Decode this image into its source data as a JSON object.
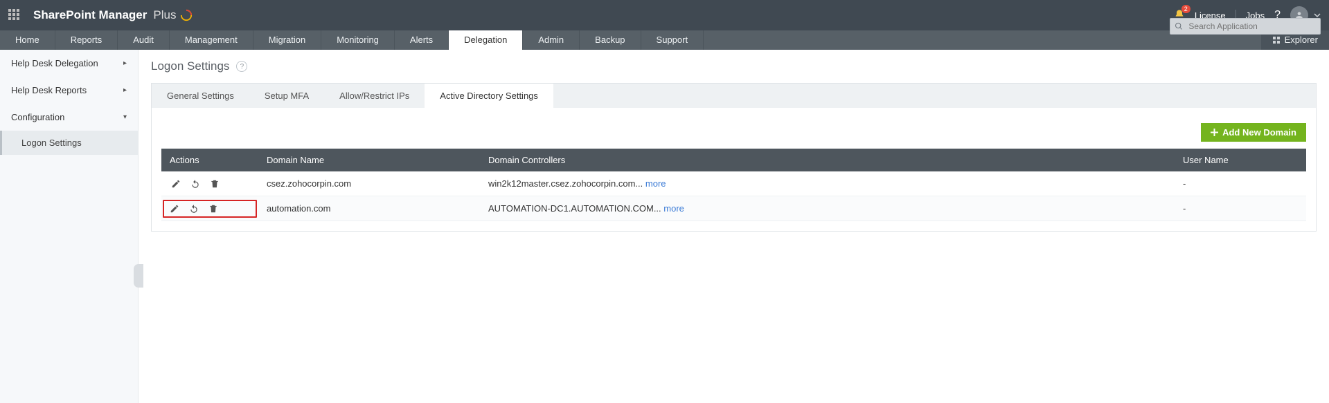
{
  "header": {
    "brand_strong": "SharePoint Manager",
    "brand_light": "Plus",
    "notification_count": "2",
    "license_label": "License",
    "jobs_label": "Jobs",
    "help_label": "?",
    "search_placeholder": "Search Application"
  },
  "nav": {
    "items": [
      "Home",
      "Reports",
      "Audit",
      "Management",
      "Migration",
      "Monitoring",
      "Alerts",
      "Delegation",
      "Admin",
      "Backup",
      "Support"
    ],
    "active_index": 7,
    "explorer_label": "Explorer"
  },
  "sidebar": {
    "items": [
      {
        "label": "Help Desk Delegation",
        "expandable": true,
        "chev": "▸"
      },
      {
        "label": "Help Desk Reports",
        "expandable": true,
        "chev": "▸"
      },
      {
        "label": "Configuration",
        "expandable": true,
        "chev": "▾"
      }
    ],
    "sub_active": "Logon Settings"
  },
  "page": {
    "title": "Logon Settings",
    "tabs": [
      "General Settings",
      "Setup MFA",
      "Allow/Restrict IPs",
      "Active Directory Settings"
    ],
    "active_tab_index": 3,
    "add_btn": "Add New Domain",
    "table": {
      "headers": [
        "Actions",
        "Domain Name",
        "Domain Controllers",
        "User Name"
      ],
      "rows": [
        {
          "domain": "csez.zohocorpin.com",
          "dc": "win2k12master.csez.zohocorpin.com... ",
          "more": "more",
          "user": "-",
          "highlight": false
        },
        {
          "domain": "automation.com",
          "dc": "AUTOMATION-DC1.AUTOMATION.COM... ",
          "more": "more",
          "user": "-",
          "highlight": true
        }
      ]
    }
  }
}
